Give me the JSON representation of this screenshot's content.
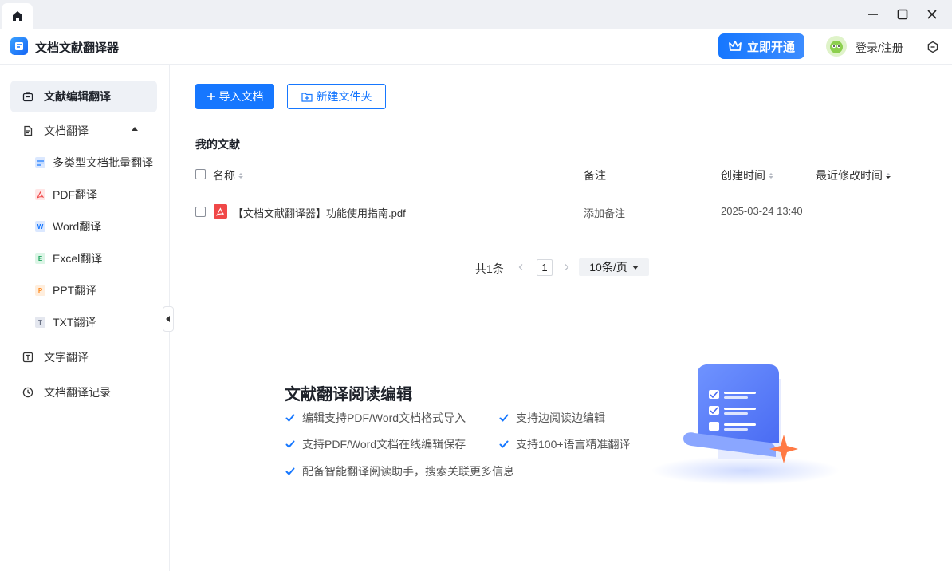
{
  "app": {
    "title": "文档文献翻译器"
  },
  "header": {
    "vip_label": "立即开通",
    "login_label": "登录/注册"
  },
  "sidebar": {
    "items": [
      {
        "label": "文献编辑翻译"
      },
      {
        "label": "文档翻译"
      },
      {
        "label": "文字翻译"
      },
      {
        "label": "文档翻译记录"
      }
    ],
    "sub_items": [
      {
        "label": "多类型文档批量翻译",
        "badge": ""
      },
      {
        "label": "PDF翻译",
        "badge": ""
      },
      {
        "label": "Word翻译",
        "badge": "W"
      },
      {
        "label": "Excel翻译",
        "badge": "E"
      },
      {
        "label": "PPT翻译",
        "badge": "P"
      },
      {
        "label": "TXT翻译",
        "badge": "T"
      }
    ]
  },
  "toolbar": {
    "import_label": "导入文档",
    "new_folder_label": "新建文件夹"
  },
  "section": {
    "title": "我的文献"
  },
  "table": {
    "columns": [
      "名称",
      "备注",
      "创建时间",
      "最近修改时间"
    ],
    "rows": [
      {
        "name": "【文档文献翻译器】功能使用指南.pdf",
        "note": "添加备注",
        "created": "2025-03-24 13:40",
        "modified": ""
      }
    ]
  },
  "pagination": {
    "total": "共1条",
    "page": "1",
    "page_size": "10条/页"
  },
  "promo": {
    "title": "文献翻译阅读编辑",
    "features": [
      "编辑支持PDF/Word文档格式导入",
      "支持边阅读边编辑",
      "支持PDF/Word文档在线编辑保存",
      "支持100+语言精准翻译",
      "配备智能翻译阅读助手，搜索关联更多信息"
    ]
  },
  "colors": {
    "accent": "#1677ff",
    "pdf": "#f04848"
  }
}
